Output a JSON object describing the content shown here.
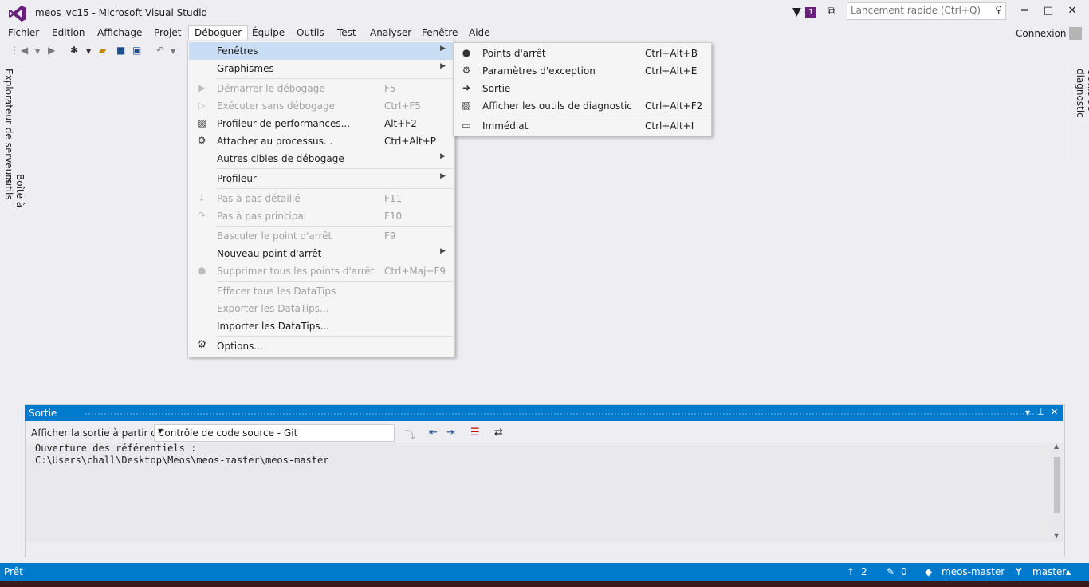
{
  "window": {
    "title": "meos_vc15 - Microsoft Visual Studio"
  },
  "notifications": {
    "count": "1"
  },
  "quick_launch": {
    "placeholder": "Lancement rapide (Ctrl+Q)"
  },
  "window_controls": {
    "minimize": "━",
    "maximize": "□",
    "close": "✕"
  },
  "menubar": {
    "items": [
      "Fichier",
      "Edition",
      "Affichage",
      "Projet",
      "Déboguer",
      "Équipe",
      "Outils",
      "Test",
      "Analyser",
      "Fenêtre",
      "Aide"
    ]
  },
  "account": {
    "label": "Connexion"
  },
  "side_tabs": {
    "left_1": "Explorateur de serveurs",
    "left_2": "Boîte à outils",
    "right_1": "Outils de diagnostic"
  },
  "debug_menu": {
    "items": [
      {
        "label": "Fenêtres",
        "shortcut": "",
        "submenu": true,
        "icon": "",
        "disabled": false
      },
      {
        "label": "Graphismes",
        "shortcut": "",
        "submenu": true,
        "icon": "",
        "disabled": false
      },
      {
        "label": "Démarrer le débogage",
        "shortcut": "F5",
        "submenu": false,
        "icon": "play-icon",
        "disabled": true
      },
      {
        "label": "Exécuter sans débogage",
        "shortcut": "Ctrl+F5",
        "submenu": false,
        "icon": "play-outline-icon",
        "disabled": true
      },
      {
        "label": "Profileur de performances...",
        "shortcut": "Alt+F2",
        "submenu": false,
        "icon": "chart-icon",
        "disabled": false
      },
      {
        "label": "Attacher au processus...",
        "shortcut": "Ctrl+Alt+P",
        "submenu": false,
        "icon": "gears-icon",
        "disabled": false
      },
      {
        "label": "Autres cibles de débogage",
        "shortcut": "",
        "submenu": true,
        "icon": "",
        "disabled": false
      },
      {
        "label": "Profileur",
        "shortcut": "",
        "submenu": true,
        "icon": "",
        "disabled": false
      },
      {
        "label": "Pas à pas détaillé",
        "shortcut": "F11",
        "submenu": false,
        "icon": "step-into-icon",
        "disabled": true
      },
      {
        "label": "Pas à pas principal",
        "shortcut": "F10",
        "submenu": false,
        "icon": "step-over-icon",
        "disabled": true
      },
      {
        "label": "Basculer le point d'arrêt",
        "shortcut": "F9",
        "submenu": false,
        "icon": "",
        "disabled": true
      },
      {
        "label": "Nouveau point d'arrêt",
        "shortcut": "",
        "submenu": true,
        "icon": "",
        "disabled": false
      },
      {
        "label": "Supprimer tous les points d'arrêt",
        "shortcut": "Ctrl+Maj+F9",
        "submenu": false,
        "icon": "breakpoints-icon",
        "disabled": true
      },
      {
        "label": "Effacer tous les DataTips",
        "shortcut": "",
        "submenu": false,
        "icon": "",
        "disabled": true
      },
      {
        "label": "Exporter les DataTips...",
        "shortcut": "",
        "submenu": false,
        "icon": "",
        "disabled": true
      },
      {
        "label": "Importer les DataTips...",
        "shortcut": "",
        "submenu": false,
        "icon": "",
        "disabled": false
      },
      {
        "label": "Options...",
        "shortcut": "",
        "submenu": false,
        "icon": "gear-icon",
        "disabled": false
      }
    ]
  },
  "windows_submenu": {
    "items": [
      {
        "label": "Points d'arrêt",
        "shortcut": "Ctrl+Alt+B",
        "icon": "breakpoint-icon"
      },
      {
        "label": "Paramètres d'exception",
        "shortcut": "Ctrl+Alt+E",
        "icon": "exception-icon"
      },
      {
        "label": "Sortie",
        "shortcut": "",
        "icon": "output-icon"
      },
      {
        "label": "Afficher les outils de diagnostic",
        "shortcut": "Ctrl+Alt+F2",
        "icon": "diagnostic-icon"
      },
      {
        "label": "Immédiat",
        "shortcut": "Ctrl+Alt+I",
        "icon": "immediate-icon"
      }
    ]
  },
  "output": {
    "title": "Sortie",
    "source_label": "Afficher la sortie à partir de :",
    "source_value": "Contrôle de code source - Git",
    "text": "Ouverture des référentiels :\nC:\\Users\\chall\\Desktop\\Meos\\meos-master\\meos-master"
  },
  "statusbar": {
    "status": "Prêt",
    "commits": "2",
    "pending": "0",
    "repo": "meos-master",
    "branch": "master"
  },
  "colors": {
    "accent": "#007acc",
    "highlight": "#c9def5",
    "vs_purple": "#68217a"
  }
}
